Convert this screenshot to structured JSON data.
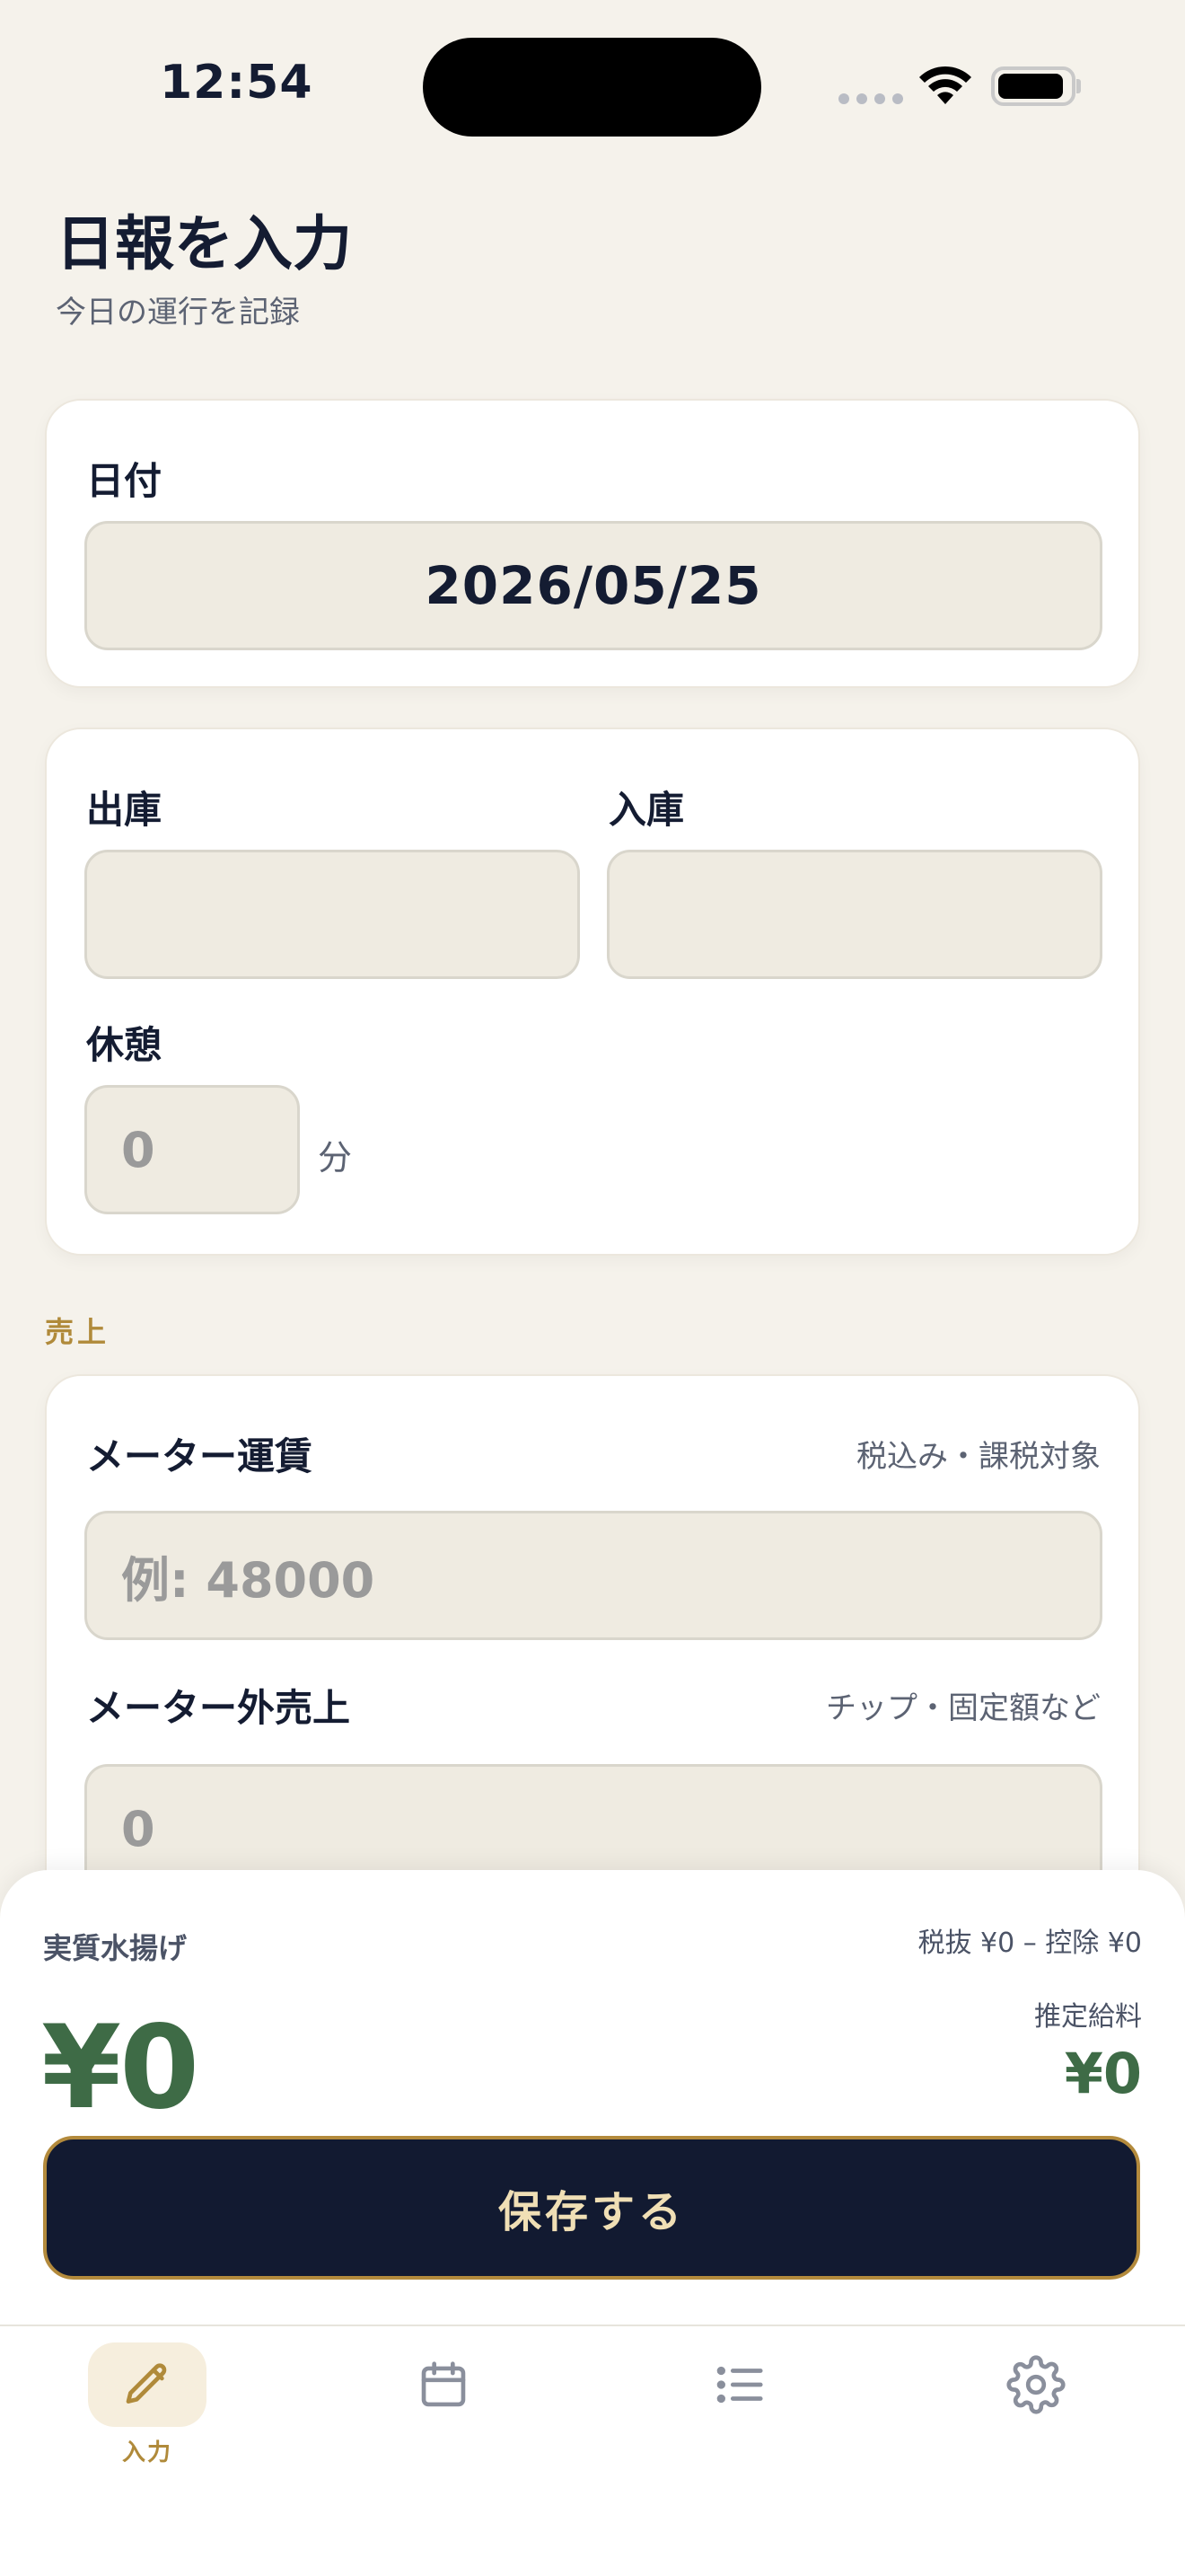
{
  "status": {
    "time": "12:54"
  },
  "header": {
    "title": "日報を入力",
    "subtitle": "今日の運行を記録"
  },
  "date_card": {
    "label": "日付",
    "value": "2026/05/25"
  },
  "time_card": {
    "out_label": "出庫",
    "out_value": "",
    "in_label": "入庫",
    "in_value": "",
    "break_label": "休憩",
    "break_placeholder": "0",
    "break_unit": "分"
  },
  "sales": {
    "section_label": "売上",
    "meter_fare_label": "メーター運賃",
    "meter_fare_hint": "税込み・課税対象",
    "meter_fare_placeholder": "例: 48000",
    "other_sales_label": "メーター外売上",
    "other_sales_hint": "チップ・固定額など",
    "other_sales_placeholder": "0"
  },
  "summary": {
    "label": "実質水揚げ",
    "breakdown": "税抜 ¥0 – 控除 ¥0",
    "amount": "¥0",
    "salary_label": "推定給料",
    "salary_amount": "¥0",
    "save_label": "保存する"
  },
  "tabbar": {
    "tabs": [
      {
        "label": "入力",
        "icon": "pencil-icon",
        "active": true
      },
      {
        "label": "",
        "icon": "calendar-icon",
        "active": false
      },
      {
        "label": "",
        "icon": "list-icon",
        "active": false
      },
      {
        "label": "",
        "icon": "gear-icon",
        "active": false
      }
    ]
  },
  "colors": {
    "background": "#f5f2eb",
    "navy": "#121a31",
    "gold": "#b08a3a",
    "green": "#3e6b46"
  }
}
